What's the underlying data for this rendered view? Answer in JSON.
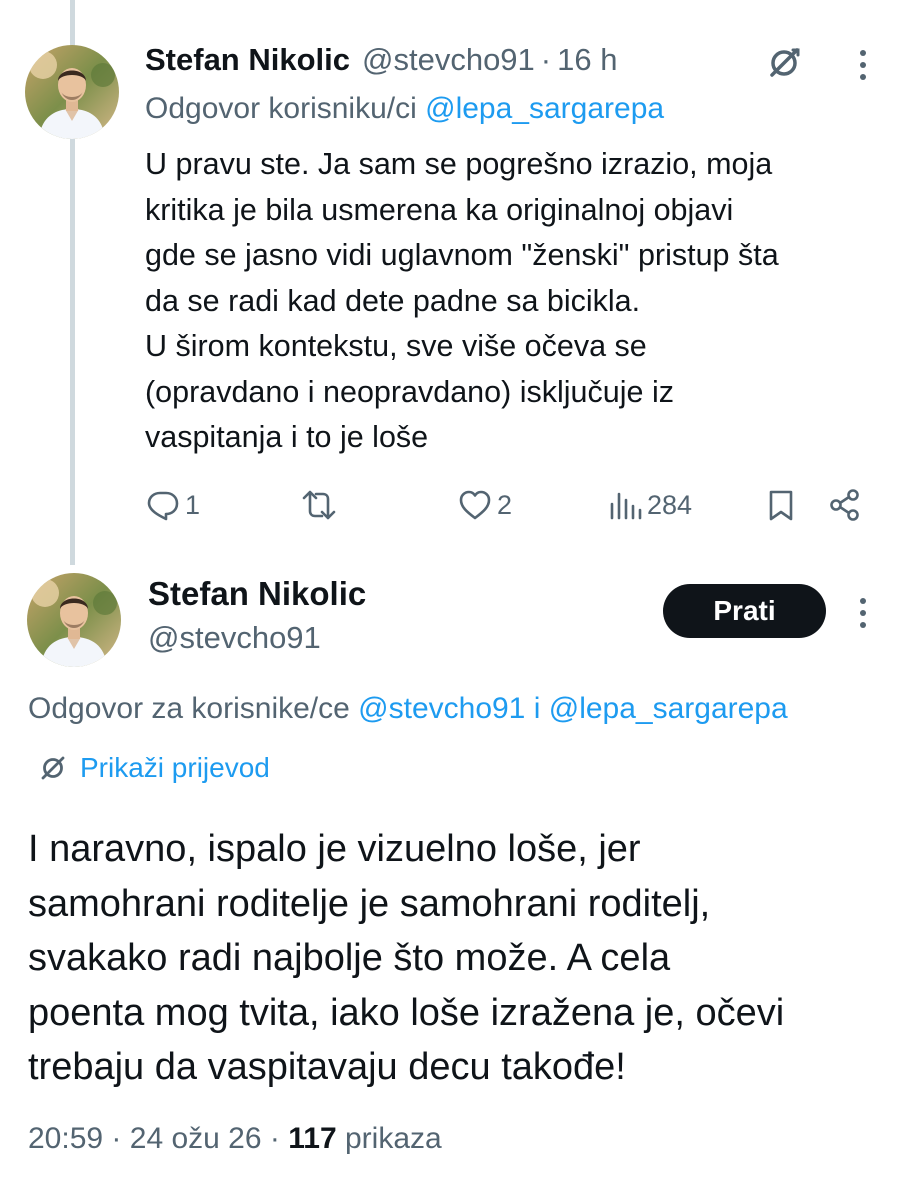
{
  "colors": {
    "text": "#0f1419",
    "secondary": "#536471",
    "link": "#1d9bf0",
    "thread_line": "#cfd9de",
    "button_bg": "#0f1419"
  },
  "tweet1": {
    "display_name": "Stefan Nikolic",
    "handle": "@stevcho91",
    "separator": "·",
    "time": "16 h",
    "reply_prefix": "Odgovor korisniku/ci",
    "reply_mention": "@lepa_sargarepa",
    "body_lines": [
      "U pravu ste. Ja sam se pogrešno izrazio, moja",
      "kritika je bila usmerena ka originalnoj objavi",
      "gde se jasno vidi uglavnom \"ženski\" pristup šta",
      "da se radi kad dete padne sa bicikla.",
      "U širom kontekstu, sve više očeva se",
      "(opravdano i neopravdano) isključuje iz",
      "vaspitanja i to je loše"
    ],
    "actions": {
      "replies": "1",
      "reposts": "",
      "likes": "2",
      "views": "284"
    },
    "icons": [
      "grok-icon",
      "more-icon",
      "reply-icon",
      "repost-icon",
      "like-icon",
      "views-icon",
      "bookmark-icon",
      "share-icon"
    ]
  },
  "tweet2": {
    "display_name": "Stefan Nikolic",
    "handle": "@stevcho91",
    "follow_label": "Prati",
    "reply_prefix": "Odgovor za korisnike/ce",
    "reply_mention_1": "@stevcho91",
    "reply_joiner": "i",
    "reply_mention_2": "@lepa_sargarepa",
    "translate_label": "Prikaži prijevod",
    "body_lines": [
      "I naravno, ispalo je vizuelno loše, jer",
      "samohrani roditelje je samohrani roditelj,",
      "svakako radi najbolje što može. A cela",
      "poenta mog tvita, iako loše izražena je, očevi",
      "trebaju da vaspitavaju decu takođe!"
    ],
    "meta": {
      "time": "20:59",
      "sep1": "·",
      "date": "24 ožu 26",
      "sep2": "·",
      "views_count": "117",
      "views_label": "prikaza"
    }
  }
}
